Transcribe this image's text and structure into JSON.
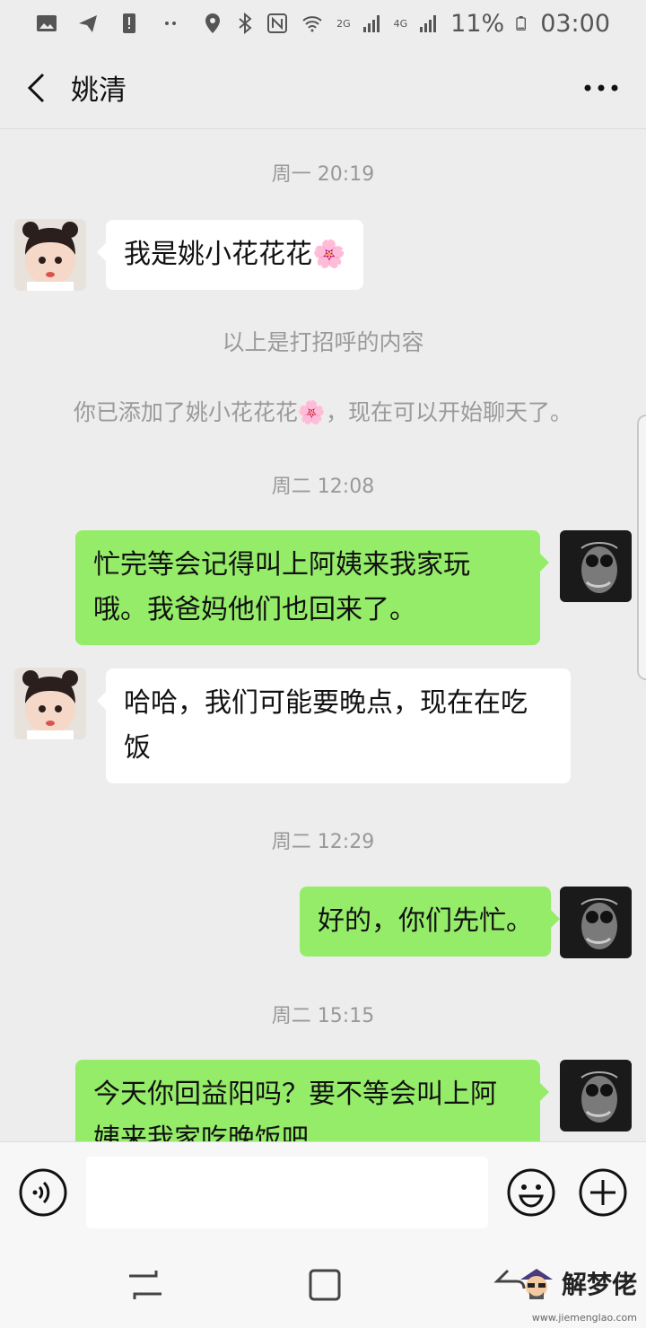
{
  "status_bar": {
    "battery": "11%",
    "time": "03:00",
    "network_2g": "2G",
    "network_4g": "4G"
  },
  "header": {
    "title": "姚清"
  },
  "messages": {
    "ts1": "周一 20:19",
    "m1": "我是姚小花花花🌸",
    "sys1": "以上是打招呼的内容",
    "sys2": "你已添加了姚小花花花🌸，现在可以开始聊天了。",
    "ts2": "周二 12:08",
    "m2": "忙完等会记得叫上阿姨来我家玩哦。我爸妈他们也回来了。",
    "m3": "哈哈，我们可能要晚点，现在在吃饭",
    "ts3": "周二 12:29",
    "m4": "好的，你们先忙。",
    "ts4": "周二 15:15",
    "m5": "今天你回益阳吗？要不等会叫上阿姨来我家吃晚饭吧"
  },
  "watermark": {
    "text": "解梦佬",
    "url": "www.jiemenglao.com"
  },
  "colors": {
    "background": "#ededed",
    "outgoing_bubble": "#95ec69",
    "incoming_bubble": "#ffffff"
  },
  "icons": [
    "image-icon",
    "send-icon",
    "alert-icon",
    "location-icon",
    "bluetooth-icon",
    "nfc-icon",
    "wifi-icon",
    "signal-icon",
    "battery-icon",
    "back-arrow-icon",
    "more-icon",
    "voice-icon",
    "emoji-icon",
    "plus-icon",
    "recent-apps-icon",
    "home-icon",
    "nav-back-icon"
  ]
}
